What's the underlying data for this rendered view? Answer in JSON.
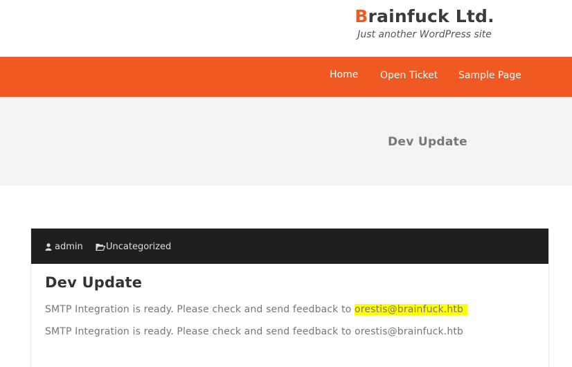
{
  "site": {
    "title_first": "B",
    "title_rest": "rainfuck Ltd.",
    "tagline": "Just another WordPress site",
    "accent_color": "#f05a22"
  },
  "nav": {
    "items": [
      {
        "label": "Home"
      },
      {
        "label": "Open Ticket"
      },
      {
        "label": "Sample Page"
      }
    ]
  },
  "banner": {
    "title": "Dev Update"
  },
  "post": {
    "author": "admin",
    "category": "Uncategorized",
    "author_icon": "user-icon",
    "category_icon": "folder-open-icon",
    "title": "Dev Update",
    "line1_prefix": "SMTP Integration is ready. Please check and send feedback to ",
    "line1_email": "orestis@brainfuck.htb",
    "line2": "SMTP Integration is ready. Please check and send feedback to orestis@brainfuck.htb",
    "highlight_color": "#ffff00"
  }
}
